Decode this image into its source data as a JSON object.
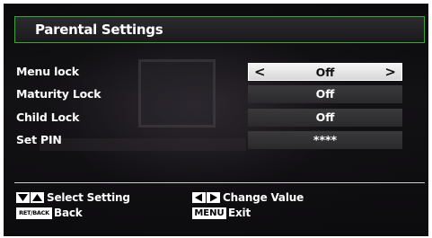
{
  "menu": {
    "title": "Parental Settings",
    "rows": [
      {
        "label": "Menu lock",
        "value": "Off",
        "selected": true
      },
      {
        "label": "Maturity Lock",
        "value": "Off",
        "selected": false
      },
      {
        "label": "Child Lock",
        "value": "Off",
        "selected": false
      },
      {
        "label": "Set PIN",
        "value": "****",
        "selected": false
      }
    ]
  },
  "footer": {
    "select_setting": "Select Setting",
    "change_value": "Change Value",
    "back": "Back",
    "exit": "Exit",
    "retback_key": "RET/BACK",
    "menu_key": "MENU"
  },
  "colors": {
    "title_border": "#3fa33a",
    "selected_value_bg": "#e8e8e8",
    "value_bg": "#333234"
  }
}
